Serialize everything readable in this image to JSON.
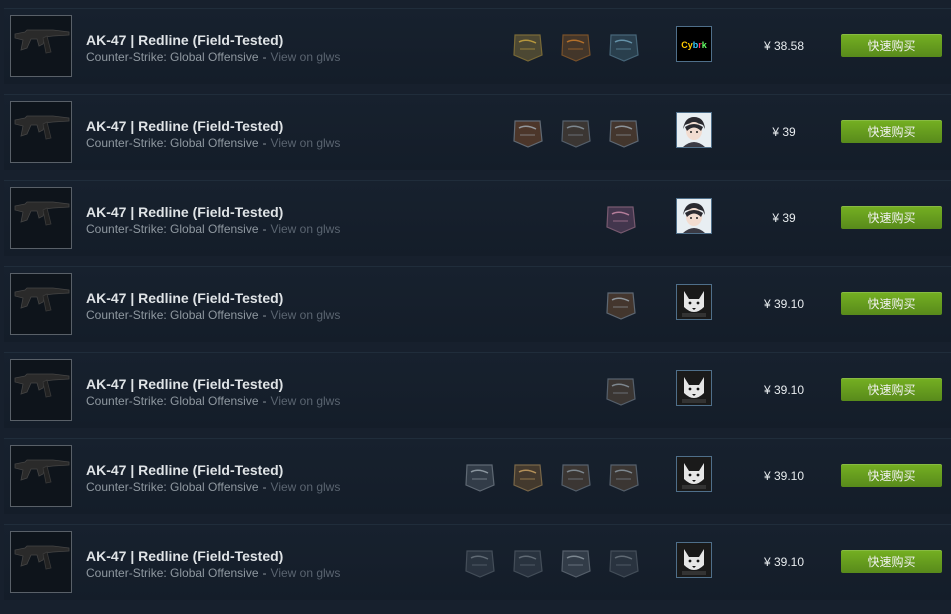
{
  "listings": [
    {
      "name": "AK-47 | Redline (Field-Tested)",
      "game": "Counter-Strike: Global Offensive",
      "separator": "-",
      "link": "View on glws",
      "stickers": [
        "navi-sticker-icon",
        "fnatic-sticker-icon",
        "team-sticker-icon"
      ],
      "stickers_start": 510,
      "avatar": "cybrk-avatar",
      "price": "¥ 38.58",
      "buy_label": "快速购买"
    },
    {
      "name": "AK-47 | Redline (Field-Tested)",
      "game": "Counter-Strike: Global Offensive",
      "separator": "-",
      "link": "View on glws",
      "stickers": [
        "neo-autograph-sticker-icon",
        "autograph-sticker-icon",
        "byali-autograph-sticker-icon"
      ],
      "stickers_start": 510,
      "avatar": "anime-avatar",
      "price": "¥ 39",
      "buy_label": "快速购买"
    },
    {
      "name": "AK-47 | Redline (Field-Tested)",
      "game": "Counter-Strike: Global Offensive",
      "separator": "-",
      "link": "View on glws",
      "stickers": [
        "pink-holo-sticker-icon"
      ],
      "stickers_start": 603,
      "avatar": "anime-avatar",
      "price": "¥ 39",
      "buy_label": "快速购买"
    },
    {
      "name": "AK-47 | Redline (Field-Tested)",
      "game": "Counter-Strike: Global Offensive",
      "separator": "-",
      "link": "View on glws",
      "stickers": [
        "byali-autograph-sticker-icon"
      ],
      "stickers_start": 603,
      "avatar": "wolf-avatar",
      "price": "¥ 39.10",
      "buy_label": "快速购买"
    },
    {
      "name": "AK-47 | Redline (Field-Tested)",
      "game": "Counter-Strike: Global Offensive",
      "separator": "-",
      "link": "View on glws",
      "stickers": [
        "autograph-sticker-icon"
      ],
      "stickers_start": 603,
      "avatar": "wolf-avatar",
      "price": "¥ 39.10",
      "buy_label": "快速购买"
    },
    {
      "name": "AK-47 | Redline (Field-Tested)",
      "game": "Counter-Strike: Global Offensive",
      "separator": "-",
      "link": "View on glws",
      "stickers": [
        "tsm-sticker-icon",
        "flusha-autograph-sticker-icon",
        "autograph-sticker-icon",
        "autograph-sticker-icon"
      ],
      "stickers_start": 462,
      "avatar": "wolf-avatar",
      "price": "¥ 39.10",
      "buy_label": "快速购买"
    },
    {
      "name": "AK-47 | Redline (Field-Tested)",
      "game": "Counter-Strike: Global Offensive",
      "separator": "-",
      "link": "View on glws",
      "stickers": [
        "team-badge-sticker-icon",
        "team-badge-sticker-icon",
        "bird-sticker-icon",
        "team-badge-sticker-icon"
      ],
      "stickers_start": 462,
      "avatar": "wolf-avatar",
      "price": "¥ 39.10",
      "buy_label": "快速购买"
    }
  ]
}
